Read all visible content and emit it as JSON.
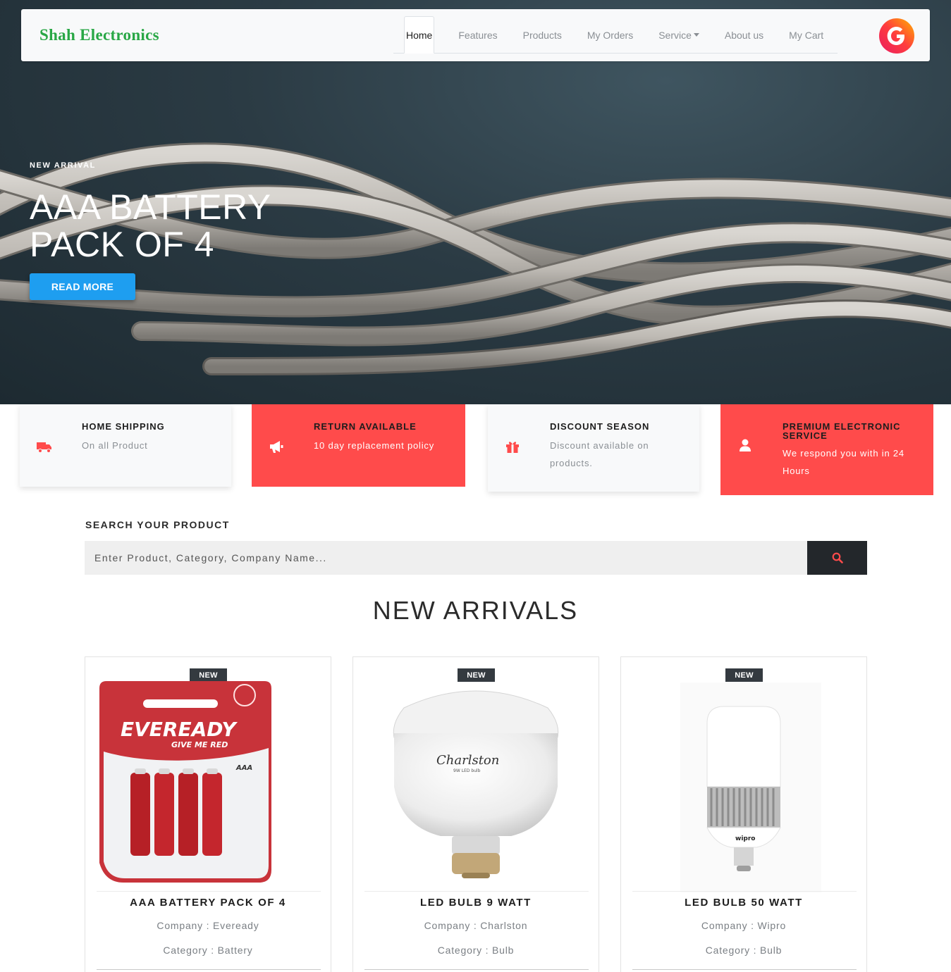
{
  "brand": "Shah Electronics",
  "nav": {
    "items": [
      {
        "label": "Home"
      },
      {
        "label": "Features"
      },
      {
        "label": "Products"
      },
      {
        "label": "My Orders"
      },
      {
        "label": "Service"
      },
      {
        "label": "About us"
      },
      {
        "label": "My Cart"
      }
    ],
    "active": "Home"
  },
  "hero": {
    "eyebrow": "NEW ARRIVAL",
    "title": "AAA BATTERY PACK OF 4",
    "button": "READ MORE"
  },
  "features": [
    {
      "icon": "truck-icon",
      "title": "HOME SHIPPING",
      "desc": "On all Product"
    },
    {
      "icon": "megaphone-icon",
      "title": "RETURN AVAILABLE",
      "desc": "10 day replacement policy"
    },
    {
      "icon": "gift-icon",
      "title": "DISCOUNT SEASON",
      "desc": "Discount available on products."
    },
    {
      "icon": "user-icon",
      "title": "PREMIUM ELECTRONIC SERVICE",
      "desc": "We respond you with in 24 Hours"
    }
  ],
  "search": {
    "label": "SEARCH YOUR PRODUCT",
    "placeholder": "Enter Product, Category, Company Name..."
  },
  "new_arrivals": {
    "title": "NEW ARRIVALS",
    "products": [
      {
        "badge": "NEW",
        "name": "AAA BATTERY PACK OF 4",
        "company": "Company : Eveready",
        "category": "Category : Battery",
        "image_text": "EVEREADY",
        "image_subtext": "GIVE ME RED",
        "image_pack_text": "AAA"
      },
      {
        "badge": "NEW",
        "name": "LED BULB 9 WATT",
        "company": "Company : Charlston",
        "category": "Category : Bulb",
        "image_text": "Charlston",
        "image_subtext": "9W LED bulb"
      },
      {
        "badge": "NEW",
        "name": "LED BULB 50 WATT",
        "company": "Company : Wipro",
        "category": "Category : Bulb",
        "image_text": "wipro"
      }
    ]
  },
  "colors": {
    "brand": "#28a745",
    "accent_red": "#ff4b4b",
    "hero_button": "#1e9ef0",
    "search_button": "#23272b"
  }
}
